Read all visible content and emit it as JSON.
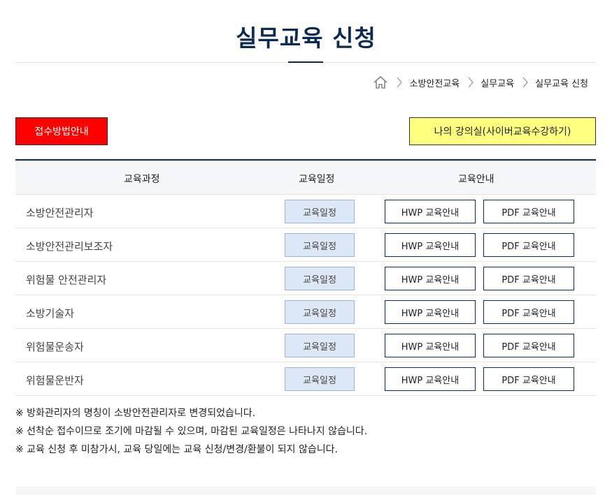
{
  "page": {
    "title": "실무교육 신청"
  },
  "breadcrumb": {
    "home_icon": "home-icon",
    "items": [
      "소방안전교육",
      "실무교육",
      "실무교육 신청"
    ]
  },
  "actions": {
    "apply_guide_label": "접수방법안내",
    "my_classroom_label": "나의 강의실(사이버교육수강하기)",
    "apply_guide_color": "#ff0000",
    "my_classroom_color": "#ffff80"
  },
  "table": {
    "headers": {
      "course": "교육과정",
      "schedule": "교육일정",
      "guide": "교육안내"
    },
    "rows": [
      {
        "course": "소방안전관리자",
        "schedule_btn": "교육일정",
        "hwp_btn": "HWP 교육안내",
        "pdf_btn": "PDF 교육안내"
      },
      {
        "course": "소방안전관리보조자",
        "schedule_btn": "교육일정",
        "hwp_btn": "HWP 교육안내",
        "pdf_btn": "PDF 교육안내"
      },
      {
        "course": "위험물 안전관리자",
        "schedule_btn": "교육일정",
        "hwp_btn": "HWP 교육안내",
        "pdf_btn": "PDF 교육안내"
      },
      {
        "course": "소방기술자",
        "schedule_btn": "교육일정",
        "hwp_btn": "HWP 교육안내",
        "pdf_btn": "PDF 교육안내"
      },
      {
        "course": "위험물운송자",
        "schedule_btn": "교육일정",
        "hwp_btn": "HWP 교육안내",
        "pdf_btn": "PDF 교육안내"
      },
      {
        "course": "위험물운반자",
        "schedule_btn": "교육일정",
        "hwp_btn": "HWP 교육안내",
        "pdf_btn": "PDF 교육안내"
      }
    ]
  },
  "notes": [
    "※ 방화관리자의 명칭이 소방안전관리자로 변경되었습니다.",
    "※ 선착순 접수이므로 조기에 마감될 수 있으며, 마감된 교육일정은 나타나지 않습니다.",
    "※ 교육 신청 후 미참가시, 교육 당일에는 교육 신청/변경/환불이 되지 않습니다."
  ],
  "colors": {
    "navy": "#0f2a52",
    "schedule_btn_bg": "#dce8f8"
  }
}
